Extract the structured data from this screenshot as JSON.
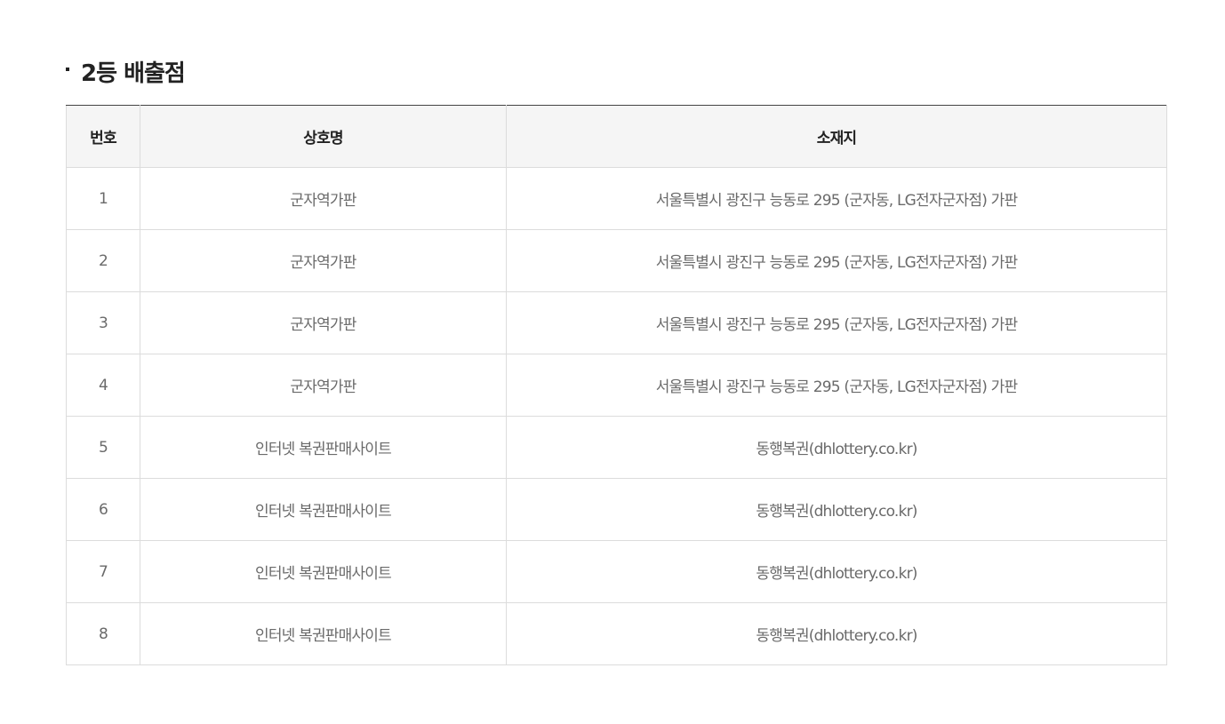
{
  "section": {
    "title": "2등 배출점"
  },
  "table": {
    "headers": {
      "no": "번호",
      "name": "상호명",
      "address": "소재지"
    },
    "rows": [
      {
        "no": "1",
        "name": "군자역가판",
        "address": "서울특별시 광진구 능동로 295 (군자동, LG전자군자점) 가판"
      },
      {
        "no": "2",
        "name": "군자역가판",
        "address": "서울특별시 광진구 능동로 295 (군자동, LG전자군자점) 가판"
      },
      {
        "no": "3",
        "name": "군자역가판",
        "address": "서울특별시 광진구 능동로 295 (군자동, LG전자군자점) 가판"
      },
      {
        "no": "4",
        "name": "군자역가판",
        "address": "서울특별시 광진구 능동로 295 (군자동, LG전자군자점) 가판"
      },
      {
        "no": "5",
        "name": "인터넷 복권판매사이트",
        "address": "동행복권(dhlottery.co.kr)"
      },
      {
        "no": "6",
        "name": "인터넷 복권판매사이트",
        "address": "동행복권(dhlottery.co.kr)"
      },
      {
        "no": "7",
        "name": "인터넷 복권판매사이트",
        "address": "동행복권(dhlottery.co.kr)"
      },
      {
        "no": "8",
        "name": "인터넷 복권판매사이트",
        "address": "동행복권(dhlottery.co.kr)"
      }
    ]
  }
}
